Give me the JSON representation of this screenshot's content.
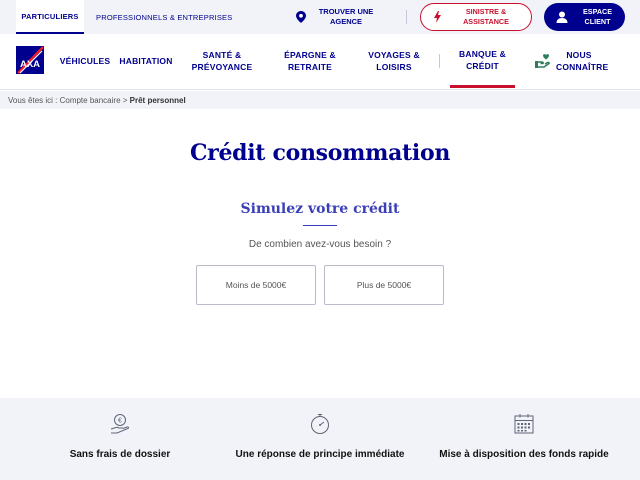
{
  "topbar": {
    "particuliers": "PARTICULIERS",
    "professionnels": "PROFESSIONNELS & ENTREPRISES",
    "agence": "TROUVER UNE AGENCE",
    "sinistre": "SINISTRE & ASSISTANCE",
    "espace": "ESPACE CLIENT"
  },
  "nav": {
    "vehicules": "VÉHICULES",
    "habitation": "HABITATION",
    "sante": "SANTÉ & PRÉVOYANCE",
    "epargne": "ÉPARGNE & RETRAITE",
    "voyages": "VOYAGES & LOISIRS",
    "banque": "BANQUE & CRÉDIT",
    "nous": "NOUS CONNAÎTRE"
  },
  "breadcrumb": {
    "prefix": "Vous êtes ici :",
    "parent": "Compte bancaire",
    "separator": ">",
    "current": "Prêt personnel"
  },
  "main": {
    "title": "Crédit consommation",
    "subtitle": "Simulez votre crédit",
    "question": "De combien avez-vous besoin ?",
    "choices": [
      "Moins de 5000€",
      "Plus de 5000€"
    ]
  },
  "features": [
    {
      "icon": "euro-hand-icon",
      "label": "Sans frais de dossier"
    },
    {
      "icon": "stopwatch-icon",
      "label": "Une réponse de principe immédiate"
    },
    {
      "icon": "calendar-icon",
      "label": "Mise à disposition des fonds rapide"
    }
  ],
  "colors": {
    "brand_blue": "#00008f",
    "accent_red": "#c8102e",
    "subtitle_blue": "#3b3fb6",
    "light_bg": "#f1f3f8"
  }
}
